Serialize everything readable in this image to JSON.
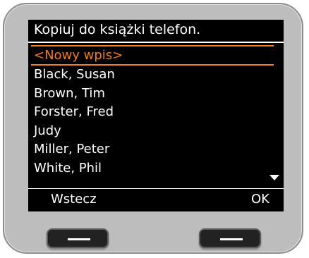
{
  "screen": {
    "title": "Kopiuj do książki telefon.",
    "entries": [
      {
        "label": "<Nowy wpis>",
        "selected": true
      },
      {
        "label": "Black, Susan",
        "selected": false
      },
      {
        "label": "Brown, Tim",
        "selected": false
      },
      {
        "label": "Forster, Fred",
        "selected": false
      },
      {
        "label": "Judy",
        "selected": false
      },
      {
        "label": "Miller, Peter",
        "selected": false
      },
      {
        "label": "White, Phil",
        "selected": false
      }
    ],
    "softkeys": {
      "left": "Wstecz",
      "right": "OK"
    },
    "scroll_icon": "scroll-down-arrow"
  },
  "colors": {
    "highlight": "#f07d1e",
    "screen_bg": "#000000",
    "device_body": "#bdbdbd"
  }
}
